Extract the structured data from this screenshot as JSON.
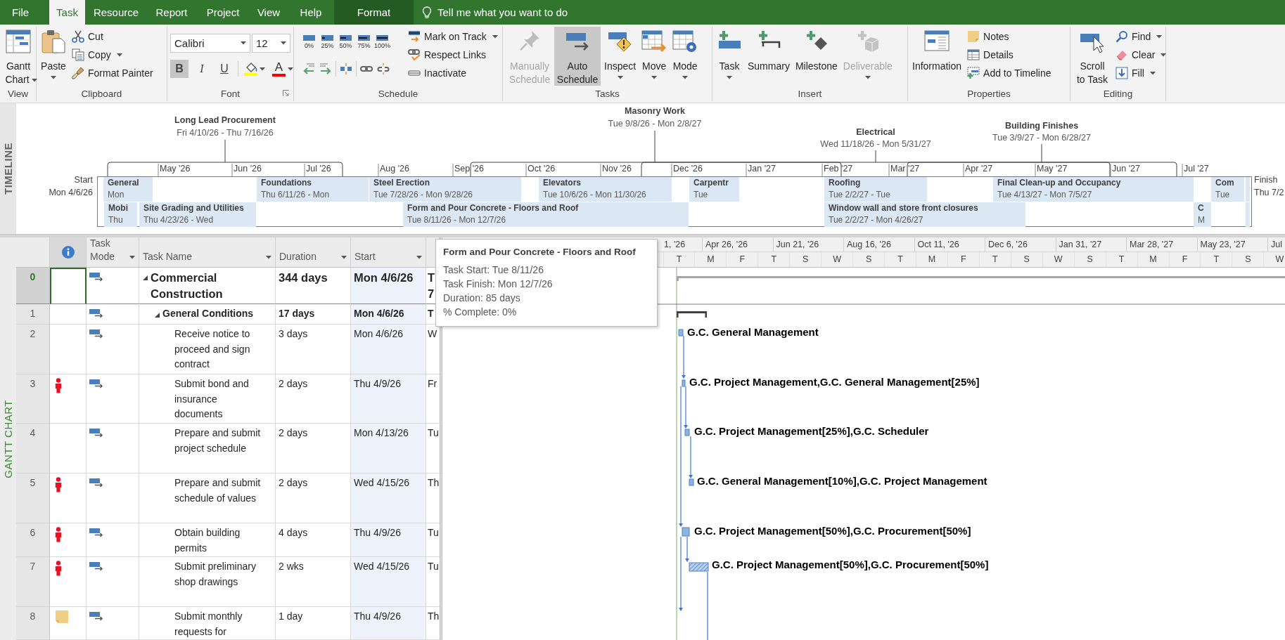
{
  "tabs": [
    {
      "label": "File",
      "kind": "backstage",
      "selected": false
    },
    {
      "label": "Task",
      "kind": "tab",
      "selected": true
    },
    {
      "label": "Resource",
      "kind": "tab",
      "selected": false
    },
    {
      "label": "Report",
      "kind": "tab",
      "selected": false
    },
    {
      "label": "Project",
      "kind": "tab",
      "selected": false
    },
    {
      "label": "View",
      "kind": "tab",
      "selected": false
    },
    {
      "label": "Help",
      "kind": "tab",
      "selected": false
    },
    {
      "label": "Format",
      "kind": "contextual",
      "selected": false
    }
  ],
  "tell_me": {
    "placeholder": "Tell me what you want to do"
  },
  "ribbon": [
    {
      "label": "View",
      "kind": "buttons",
      "items": [
        {
          "kind": "large",
          "label": "Gantt Chart",
          "dropdown": true,
          "pressed": false,
          "disabled": false
        }
      ]
    },
    {
      "label": "Clipboard",
      "kind": "buttons",
      "items": [
        {
          "kind": "large",
          "label": "Paste",
          "dropdown": true,
          "pressed": false,
          "disabled": false
        },
        {
          "kind": "small",
          "label": "Cut",
          "dropdown": false,
          "pressed": false,
          "disabled": false
        },
        {
          "kind": "small",
          "label": "Copy",
          "dropdown": true,
          "pressed": false,
          "disabled": false
        },
        {
          "kind": "small",
          "label": "Format Painter",
          "dropdown": false,
          "pressed": false,
          "disabled": false
        }
      ]
    },
    {
      "label": "Font",
      "kind": "font",
      "launcher": true,
      "items": [
        {
          "kind": "combo",
          "value": "Calibri"
        },
        {
          "kind": "combo",
          "value": "12"
        },
        {
          "kind": "toggle",
          "label": "B",
          "pressed": true
        },
        {
          "kind": "toggle",
          "label": "I",
          "pressed": false
        },
        {
          "kind": "toggle",
          "label": "U",
          "pressed": false
        },
        {
          "kind": "highlight",
          "color": "#ffff00"
        },
        {
          "kind": "font_color",
          "label": "A",
          "color": "#ff0000"
        }
      ]
    },
    {
      "label": "Schedule",
      "kind": "schedule",
      "items": [
        {
          "kind": "percent",
          "label": "0%"
        },
        {
          "kind": "percent",
          "label": "25%"
        },
        {
          "kind": "percent",
          "label": "50%"
        },
        {
          "kind": "percent",
          "label": "75%"
        },
        {
          "kind": "percent",
          "label": "100%"
        },
        {
          "kind": "tool"
        },
        {
          "kind": "tool"
        },
        {
          "kind": "tool"
        },
        {
          "kind": "tool"
        },
        {
          "kind": "tool"
        },
        {
          "kind": "small",
          "label": "Mark on Track",
          "dropdown": true,
          "pressed": false,
          "disabled": false
        },
        {
          "kind": "small",
          "label": "Respect Links",
          "dropdown": false,
          "pressed": false,
          "disabled": false
        },
        {
          "kind": "small",
          "label": "Inactivate",
          "dropdown": false,
          "pressed": false,
          "disabled": false
        }
      ]
    },
    {
      "label": "Tasks",
      "kind": "buttons",
      "items": [
        {
          "kind": "large",
          "label": "Manually Schedule",
          "dropdown": false,
          "pressed": false,
          "disabled": true
        },
        {
          "kind": "large",
          "label": "Auto Schedule",
          "dropdown": false,
          "pressed": true,
          "disabled": false
        },
        {
          "kind": "large",
          "label": "Inspect",
          "dropdown": true,
          "pressed": false,
          "disabled": false
        },
        {
          "kind": "large",
          "label": "Move",
          "dropdown": true,
          "pressed": false,
          "disabled": false
        },
        {
          "kind": "large",
          "label": "Mode",
          "dropdown": true,
          "pressed": false,
          "disabled": false
        }
      ]
    },
    {
      "label": "Insert",
      "kind": "buttons",
      "items": [
        {
          "kind": "large",
          "label": "Task",
          "dropdown": true,
          "pressed": false,
          "disabled": false
        },
        {
          "kind": "large",
          "label": "Summary",
          "dropdown": false,
          "pressed": false,
          "disabled": false
        },
        {
          "kind": "large",
          "label": "Milestone",
          "dropdown": false,
          "pressed": false,
          "disabled": false
        },
        {
          "kind": "large",
          "label": "Deliverable",
          "dropdown": true,
          "pressed": false,
          "disabled": true
        }
      ]
    },
    {
      "label": "Properties",
      "kind": "buttons",
      "items": [
        {
          "kind": "large",
          "label": "Information",
          "dropdown": false,
          "pressed": false,
          "disabled": false
        },
        {
          "kind": "small",
          "label": "Notes",
          "dropdown": false,
          "pressed": false,
          "disabled": false
        },
        {
          "kind": "small",
          "label": "Details",
          "dropdown": false,
          "pressed": false,
          "disabled": false
        },
        {
          "kind": "small",
          "label": "Add to Timeline",
          "dropdown": false,
          "pressed": false,
          "disabled": false
        }
      ]
    },
    {
      "label": "Editing",
      "kind": "buttons",
      "items": [
        {
          "kind": "large",
          "label": "Scroll to Task",
          "dropdown": false,
          "pressed": false,
          "disabled": false
        },
        {
          "kind": "small",
          "label": "Find",
          "dropdown": true,
          "pressed": false,
          "disabled": false
        },
        {
          "kind": "small",
          "label": "Clear",
          "dropdown": true,
          "pressed": false,
          "disabled": false
        },
        {
          "kind": "small",
          "label": "Fill",
          "dropdown": true,
          "pressed": false,
          "disabled": false
        }
      ]
    }
  ],
  "timeline": {
    "label": "TIMELINE",
    "start": {
      "label": "Start",
      "date": "Mon 4/6/26"
    },
    "finish": {
      "label": "Finish",
      "date": "Thu 7/2"
    },
    "callouts": [
      {
        "title": "Long Lead Procurement",
        "dates": "Fri 4/10/26 - Thu 7/16/26"
      },
      {
        "title": "Masonry Work",
        "dates": "Tue 9/8/26 - Mon 2/8/27"
      },
      {
        "title": "Electrical",
        "dates": "Wed 11/18/26 - Mon 5/31/27"
      },
      {
        "title": "Building Finishes",
        "dates": "Tue 3/9/27 - Mon 6/28/27"
      }
    ],
    "scale": [
      "May '26",
      "Jun '26",
      "Jul '26",
      "Aug '26",
      "Sep '26",
      "Oct '26",
      "Nov '26",
      "Dec '26",
      "Jan '27",
      "Feb '27",
      "Mar '27",
      "Apr '27",
      "May '27",
      "Jun '27",
      "Jul '27"
    ],
    "lanes": [
      {
        "bars": [
          {
            "kind": "labeled",
            "title": "General",
            "dates": "Mon"
          },
          {
            "kind": "labeled",
            "title": "Foundations",
            "dates": "Thu 6/11/26 - Mon"
          },
          {
            "kind": "labeled",
            "title": "Steel Erection",
            "dates": "Tue 7/28/26 - Mon 9/28/26"
          },
          {
            "kind": "labeled",
            "title": "Elevators",
            "dates": "Tue 10/6/26 - Mon 11/30/26"
          },
          {
            "kind": "labeled",
            "title": "Carpentr",
            "dates": "Tue"
          },
          {
            "kind": "labeled",
            "title": "Roofing",
            "dates": "Tue 2/2/27 - Tue"
          },
          {
            "kind": "labeled",
            "title": "Final Clean-up and Occupancy",
            "dates": "Tue 4/13/27 - Mon 7/5/27"
          },
          {
            "kind": "labeled",
            "title": "Com",
            "dates": "Tue"
          },
          {
            "kind": "narrow"
          }
        ]
      },
      {
        "bars": [
          {
            "kind": "labeled",
            "title": "Mobi",
            "dates": "Thu"
          },
          {
            "kind": "labeled",
            "title": "Site Grading and Utilities",
            "dates": "Thu 4/23/26 - Wed"
          },
          {
            "kind": "labeled",
            "title": "Form and Pour Concrete - Floors and Roof",
            "dates": "Tue 8/11/26 - Mon 12/7/26"
          },
          {
            "kind": "labeled",
            "title": "Window wall and store front closures",
            "dates": "Tue 2/2/27 - Mon 4/26/27"
          },
          {
            "kind": "labeled",
            "title": "C",
            "dates": "M"
          },
          {
            "kind": "narrow"
          }
        ]
      }
    ]
  },
  "view": {
    "label": "GANTT CHART"
  },
  "table": {
    "columns": [
      {
        "kind": "info"
      },
      {
        "kind": "field",
        "label": "Task Mode"
      },
      {
        "kind": "field",
        "label": "Task Name"
      },
      {
        "kind": "field",
        "label": "Duration"
      },
      {
        "kind": "field",
        "label": "Start"
      }
    ]
  },
  "tasks": [
    {
      "row_number": "0",
      "kind": "project_summary",
      "name": "Commercial Construction",
      "duration": "344 days",
      "start": "Mon 4/6/26",
      "finish": "T 7",
      "auto_scheduled": true,
      "selected": true,
      "overallocated": false,
      "note": false,
      "expanded": true,
      "children": [
        {
          "row_number": "1",
          "kind": "summary",
          "name": "General Conditions",
          "duration": "17 days",
          "start": "Mon 4/6/26",
          "finish": "T",
          "auto_scheduled": true,
          "selected": false,
          "overallocated": false,
          "note": false,
          "expanded": true,
          "children": [
            {
              "row_number": "2",
              "kind": "task",
              "name": "Receive notice to proceed and sign contract",
              "duration": "3 days",
              "start": "Mon 4/6/26",
              "finish": "W",
              "auto_scheduled": true,
              "selected": false,
              "overallocated": false,
              "note": false,
              "resources": "G.C. General Management"
            },
            {
              "row_number": "3",
              "kind": "task",
              "name": "Submit bond and insurance documents",
              "duration": "2 days",
              "start": "Thu 4/9/26",
              "finish": "Fr",
              "auto_scheduled": true,
              "selected": false,
              "overallocated": true,
              "note": false,
              "resources": "G.C. Project Management,G.C. General Management[25%]"
            },
            {
              "row_number": "4",
              "kind": "task",
              "name": "Prepare and submit project schedule",
              "duration": "2 days",
              "start": "Mon 4/13/26",
              "finish": "Tu",
              "auto_scheduled": true,
              "selected": false,
              "overallocated": false,
              "note": false,
              "resources": "G.C. Project Management[25%],G.C. Scheduler"
            },
            {
              "row_number": "5",
              "kind": "task",
              "name": "Prepare and submit schedule of values",
              "duration": "2 days",
              "start": "Wed 4/15/26",
              "finish": "Th",
              "auto_scheduled": true,
              "selected": false,
              "overallocated": true,
              "note": false,
              "resources": "G.C. General Management[10%],G.C. Project Management"
            },
            {
              "row_number": "6",
              "kind": "task",
              "name": "Obtain building permits",
              "duration": "4 days",
              "start": "Thu 4/9/26",
              "finish": "Tu",
              "auto_scheduled": true,
              "selected": false,
              "overallocated": true,
              "note": false,
              "resources": "G.C. Project Management[50%],G.C. Procurement[50%]"
            },
            {
              "row_number": "7",
              "kind": "hatched_task",
              "name": "Submit preliminary shop drawings",
              "duration": "2 wks",
              "start": "Wed 4/15/26",
              "finish": "Tu",
              "auto_scheduled": true,
              "selected": false,
              "overallocated": true,
              "note": false,
              "resources": "G.C. Project Management[50%],G.C. Procurement[50%]"
            },
            {
              "row_number": "8",
              "kind": "bare",
              "name": "Submit monthly requests for",
              "duration": "1 day",
              "start": "Thu 4/9/26",
              "finish": "Th",
              "auto_scheduled": true,
              "selected": false,
              "overallocated": false,
              "note": true
            }
          ]
        }
      ]
    }
  ],
  "gantt": {
    "timescale_top": [
      "1, '26",
      "Apr 26, '26",
      "Jun 21, '26",
      "Aug 16, '26",
      "Oct 11, '26",
      "Dec 6, '26",
      "Jan 31, '27",
      "Mar 28, '27",
      "May 23, '27",
      "Jul"
    ],
    "timescale_bottom": [
      "T",
      "M",
      "F",
      "T",
      "S",
      "W",
      "S",
      "T",
      "M",
      "F",
      "T",
      "S",
      "W",
      "S",
      "T",
      "M",
      "F",
      "T",
      "S",
      "W"
    ]
  },
  "tooltip": {
    "title": "Form and Pour Concrete - Floors and Roof",
    "lines": [
      "Task Start: Tue 8/11/26",
      "Task Finish: Mon 12/7/26",
      "Duration: 85 days",
      "% Complete: 0%"
    ]
  }
}
